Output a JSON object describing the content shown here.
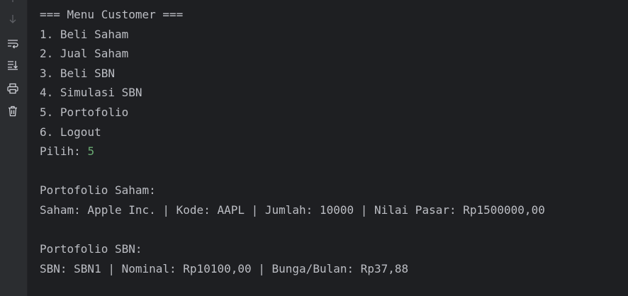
{
  "toolbar": {
    "icons": [
      "arrow-down-icon",
      "soft-wrap-icon",
      "scroll-to-end-icon",
      "print-icon",
      "trash-icon"
    ]
  },
  "console": {
    "header": "=== Menu Customer ===",
    "menu_items": [
      "1. Beli Saham",
      "2. Jual Saham",
      "3. Beli SBN",
      "4. Simulasi SBN",
      "5. Portofolio",
      "6. Logout"
    ],
    "prompt_label": "Pilih: ",
    "prompt_input": "5",
    "saham_header": "Portofolio Saham:",
    "saham_line": "Saham: Apple Inc. | Kode: AAPL | Jumlah: 10000 | Nilai Pasar: Rp1500000,00",
    "sbn_header": "Portofolio SBN:",
    "sbn_line": "SBN: SBN1 | Nominal: Rp10100,00 | Bunga/Bulan: Rp37,88"
  },
  "colors": {
    "background": "#1e1f22",
    "gutter": "#2b2d30",
    "text": "#bcbec4",
    "user_input": "#6aab73"
  }
}
